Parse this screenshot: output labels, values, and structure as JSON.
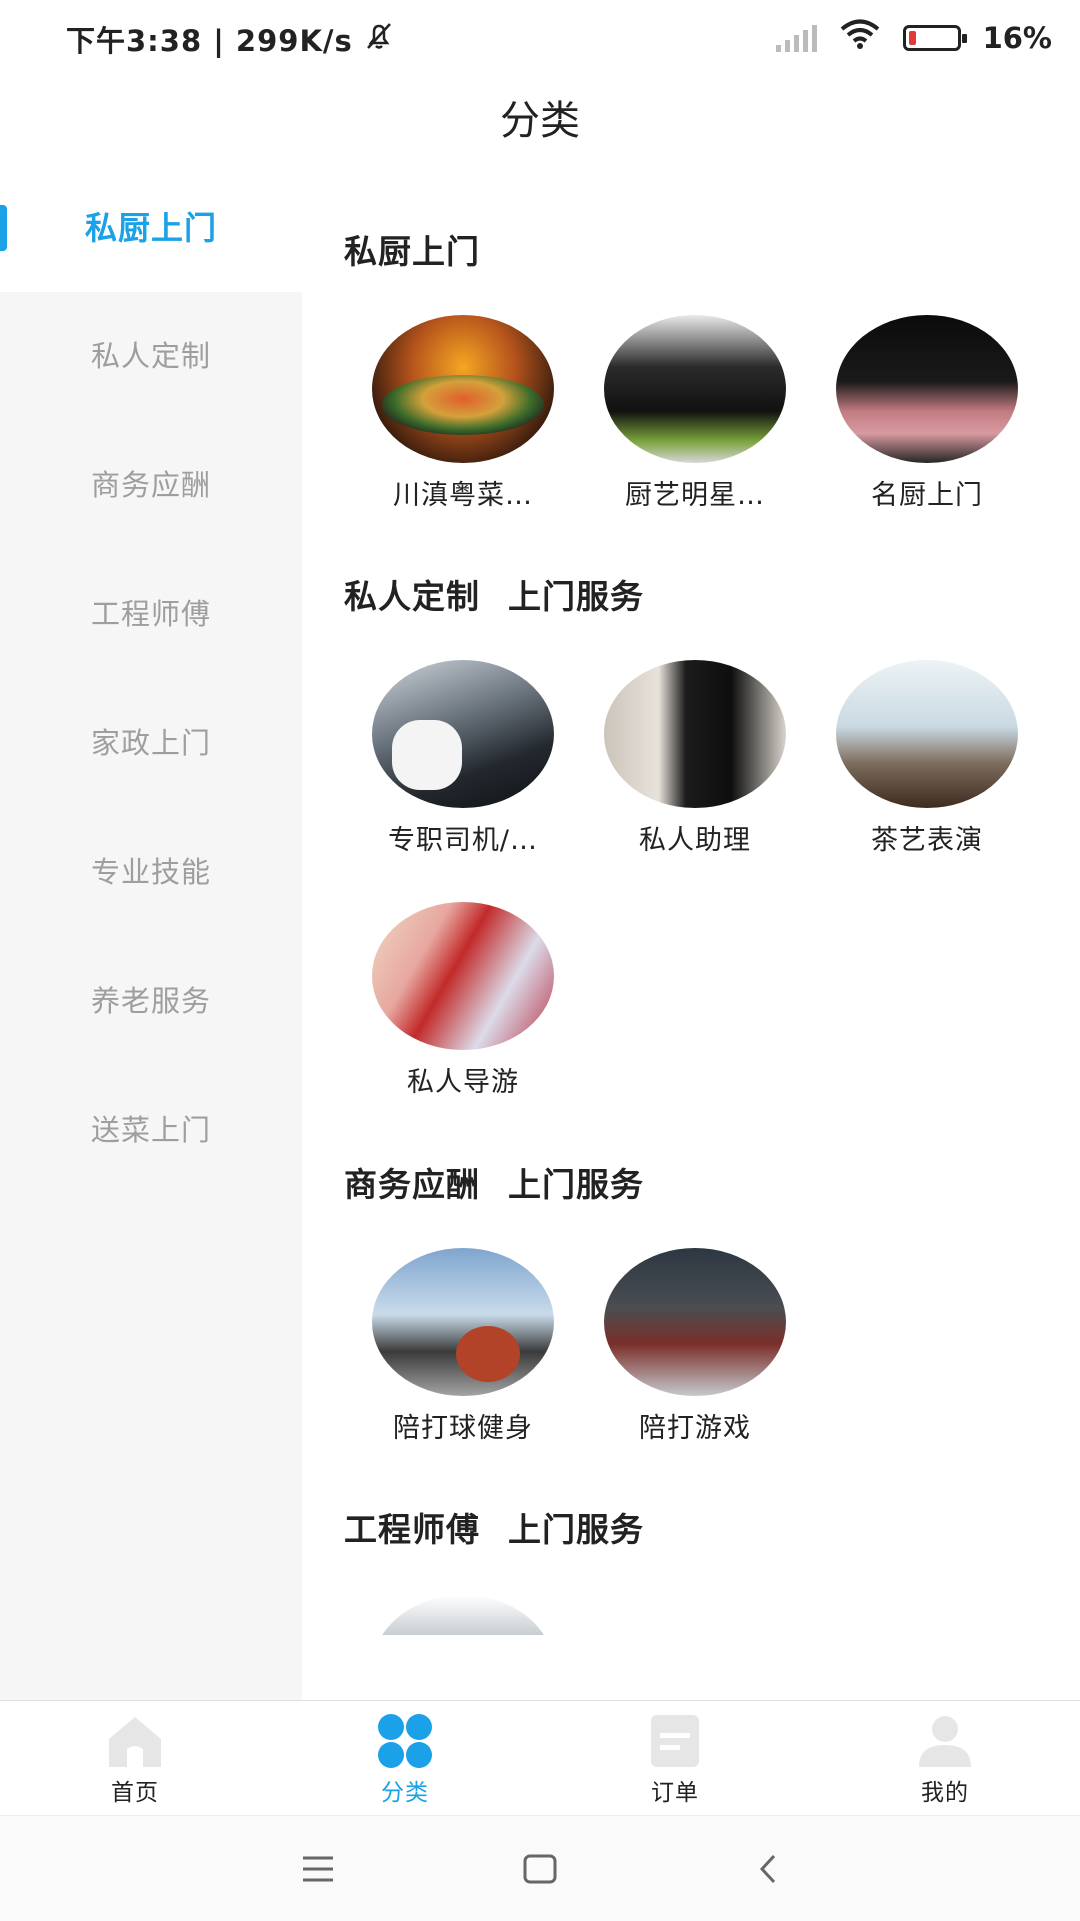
{
  "status_bar": {
    "time_speed": "下午3:38 | 299K/s",
    "battery": "16%",
    "battery_level": 0.16,
    "icons": [
      "mute-bell-icon",
      "signal-icon",
      "wifi-icon",
      "battery-icon"
    ]
  },
  "header": {
    "title": "分类"
  },
  "sidebar": {
    "items": [
      {
        "label": "私厨上门",
        "active": true
      },
      {
        "label": "私人定制",
        "active": false
      },
      {
        "label": "商务应酬",
        "active": false
      },
      {
        "label": "工程师傅",
        "active": false
      },
      {
        "label": "家政上门",
        "active": false
      },
      {
        "label": "专业技能",
        "active": false
      },
      {
        "label": "养老服务",
        "active": false
      },
      {
        "label": "送菜上门",
        "active": false
      }
    ]
  },
  "sections": [
    {
      "title": "私厨上门",
      "subtitle": "",
      "items": [
        {
          "label": "川滇粤菜…"
        },
        {
          "label": "厨艺明星…"
        },
        {
          "label": "名厨上门"
        }
      ]
    },
    {
      "title": "私人定制",
      "subtitle": "上门服务",
      "items": [
        {
          "label": "专职司机/…"
        },
        {
          "label": "私人助理"
        },
        {
          "label": "茶艺表演"
        },
        {
          "label": "私人导游"
        }
      ]
    },
    {
      "title": "商务应酬",
      "subtitle": "上门服务",
      "items": [
        {
          "label": "陪打球健身"
        },
        {
          "label": "陪打游戏"
        }
      ]
    },
    {
      "title": "工程师傅",
      "subtitle": "上门服务",
      "items": [
        {
          "label": ""
        }
      ]
    }
  ],
  "bottom_nav": {
    "items": [
      {
        "label": "首页",
        "icon": "home-icon",
        "active": false
      },
      {
        "label": "分类",
        "icon": "category-icon",
        "active": true
      },
      {
        "label": "订单",
        "icon": "order-icon",
        "active": false
      },
      {
        "label": "我的",
        "icon": "profile-icon",
        "active": false
      }
    ]
  },
  "system_nav": {
    "icons": [
      "menu-icon",
      "home-square-icon",
      "back-icon"
    ]
  },
  "colors": {
    "accent": "#1aa1e8",
    "sidebar_bg": "#f6f6f6",
    "text": "#222222",
    "muted": "#9e9e9e"
  }
}
